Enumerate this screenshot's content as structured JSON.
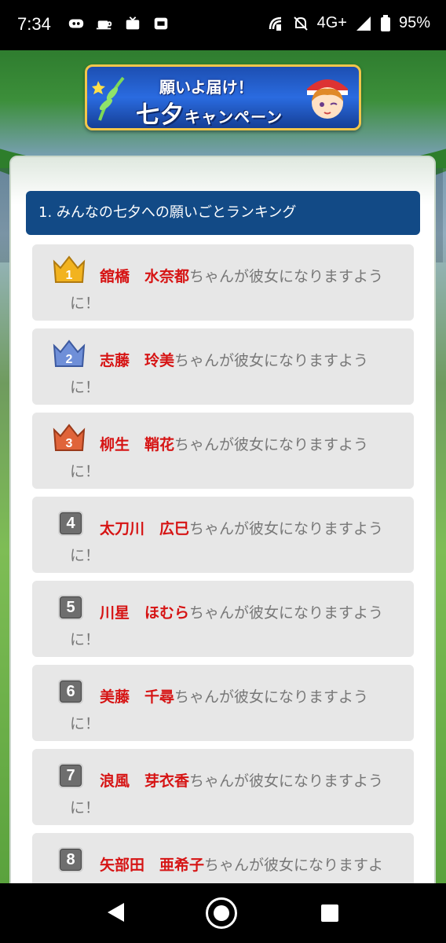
{
  "status_bar": {
    "time": "7:34",
    "network": "4G+",
    "battery": "95%"
  },
  "banner": {
    "line1": "願いよ届け！",
    "line2_big": "七夕",
    "line2_small": "キャンペーン"
  },
  "section": {
    "title": "1. みんなの七夕への願いごとランキング"
  },
  "ranking": [
    {
      "rank": "1",
      "name": "舘橋　水奈都",
      "rest": "ちゃんが彼女になりますよう",
      "line2": "に！"
    },
    {
      "rank": "2",
      "name": "志藤　玲美",
      "rest": "ちゃんが彼女になりますよう",
      "line2": "に！"
    },
    {
      "rank": "3",
      "name": "柳生　鞘花",
      "rest": "ちゃんが彼女になりますよう",
      "line2": "に！"
    },
    {
      "rank": "4",
      "name": "太刀川　広巳",
      "rest": "ちゃんが彼女になりますよう",
      "line2": "に！"
    },
    {
      "rank": "5",
      "name": "川星　ほむら",
      "rest": "ちゃんが彼女になりますよう",
      "line2": "に！"
    },
    {
      "rank": "6",
      "name": "美藤　千尋",
      "rest": "ちゃんが彼女になりますよう",
      "line2": "に！"
    },
    {
      "rank": "7",
      "name": "浪風　芽衣香",
      "rest": "ちゃんが彼女になりますよう",
      "line2": "に！"
    },
    {
      "rank": "8",
      "name": "矢部田　亜希子",
      "rest": "ちゃんが彼女になりますよ",
      "line2": ""
    }
  ],
  "colors": {
    "header_bg": "#124a86",
    "name_red": "#d61414",
    "gold": "#f2b31f",
    "silver": "#6f8fd8",
    "bronze": "#e0643a"
  }
}
